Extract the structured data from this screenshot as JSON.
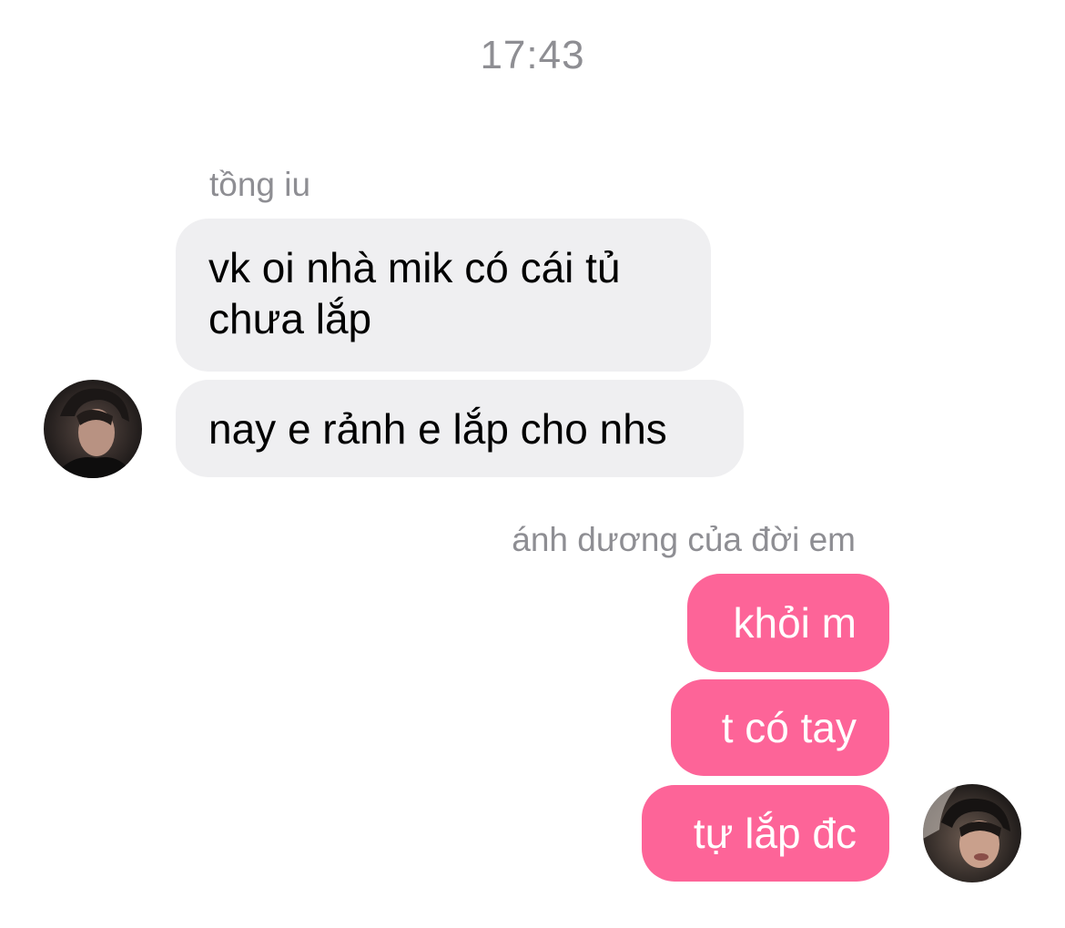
{
  "chat": {
    "timestamp": "17:43",
    "incoming": {
      "sender": "tồng iu",
      "messages": [
        "vk oi nhà mik có cái tủ chưa lắp",
        "nay e rảnh e lắp cho nhs"
      ],
      "avatar_icon": "contact-avatar"
    },
    "outgoing": {
      "sender": "ánh dương của đời em",
      "messages": [
        "khỏi m",
        "t có tay",
        "tự lắp đc"
      ],
      "avatar_icon": "user-avatar"
    }
  },
  "colors": {
    "incoming_bubble": "#efeff1",
    "outgoing_bubble": "#fd6498",
    "meta_text": "#8e8e93"
  }
}
